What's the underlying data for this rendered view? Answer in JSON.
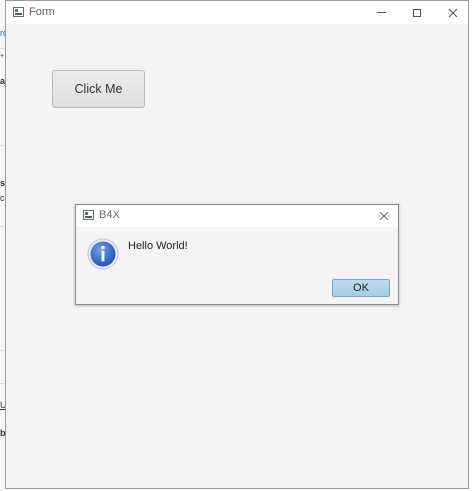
{
  "window": {
    "title": "Form",
    "minimize_icon": "minimize-icon",
    "maximize_icon": "maximize-icon",
    "close_icon": "close-icon"
  },
  "main": {
    "button_label": "Click Me"
  },
  "dialog": {
    "title": "B4X",
    "icon": "info-icon",
    "message": "Hello World!",
    "ok_label": "OK",
    "ok_color": "#a6cde6"
  },
  "background_app": {
    "fragments": [
      "rd",
      "+",
      "a",
      "s",
      "ce",
      "U",
      "b"
    ]
  }
}
